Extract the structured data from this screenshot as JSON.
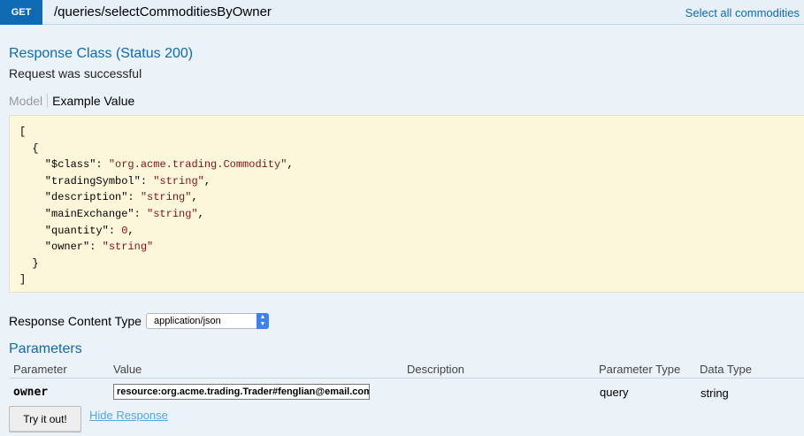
{
  "operation": {
    "method": "GET",
    "path": "/queries/selectCommoditiesByOwner",
    "summary": "Select all commodities"
  },
  "response": {
    "heading": "Response Class (Status 200)",
    "note": "Request was successful",
    "tabs": {
      "model": "Model",
      "example": "Example Value"
    },
    "example_lines": [
      {
        "t": "["
      },
      {
        "t": "  {"
      },
      {
        "k": "    \"$class\": ",
        "s": "\"org.acme.trading.Commodity\"",
        "e": ","
      },
      {
        "k": "    \"tradingSymbol\": ",
        "s": "\"string\"",
        "e": ","
      },
      {
        "k": "    \"description\": ",
        "s": "\"string\"",
        "e": ","
      },
      {
        "k": "    \"mainExchange\": ",
        "s": "\"string\"",
        "e": ","
      },
      {
        "k": "    \"quantity\": ",
        "s": "0",
        "e": ","
      },
      {
        "k": "    \"owner\": ",
        "s": "\"string\"",
        "e": ""
      },
      {
        "t": "  }"
      },
      {
        "t": "]"
      }
    ]
  },
  "content_type": {
    "label": "Response Content Type",
    "selected": "application/json"
  },
  "parameters": {
    "heading": "Parameters",
    "columns": [
      "Parameter",
      "Value",
      "Description",
      "Parameter Type",
      "Data Type"
    ],
    "rows": [
      {
        "name": "owner",
        "value": "resource:org.acme.trading.Trader#fenglian@email.com",
        "description": "",
        "param_type": "query",
        "data_type": "string"
      }
    ]
  },
  "actions": {
    "try_label": "Try it out!",
    "hide_label": "Hide Response"
  },
  "colors": {
    "accent": "#0f6ab4",
    "background": "#ebf3f9",
    "code_background": "#fcf6db",
    "string_color": "#7d1616"
  }
}
